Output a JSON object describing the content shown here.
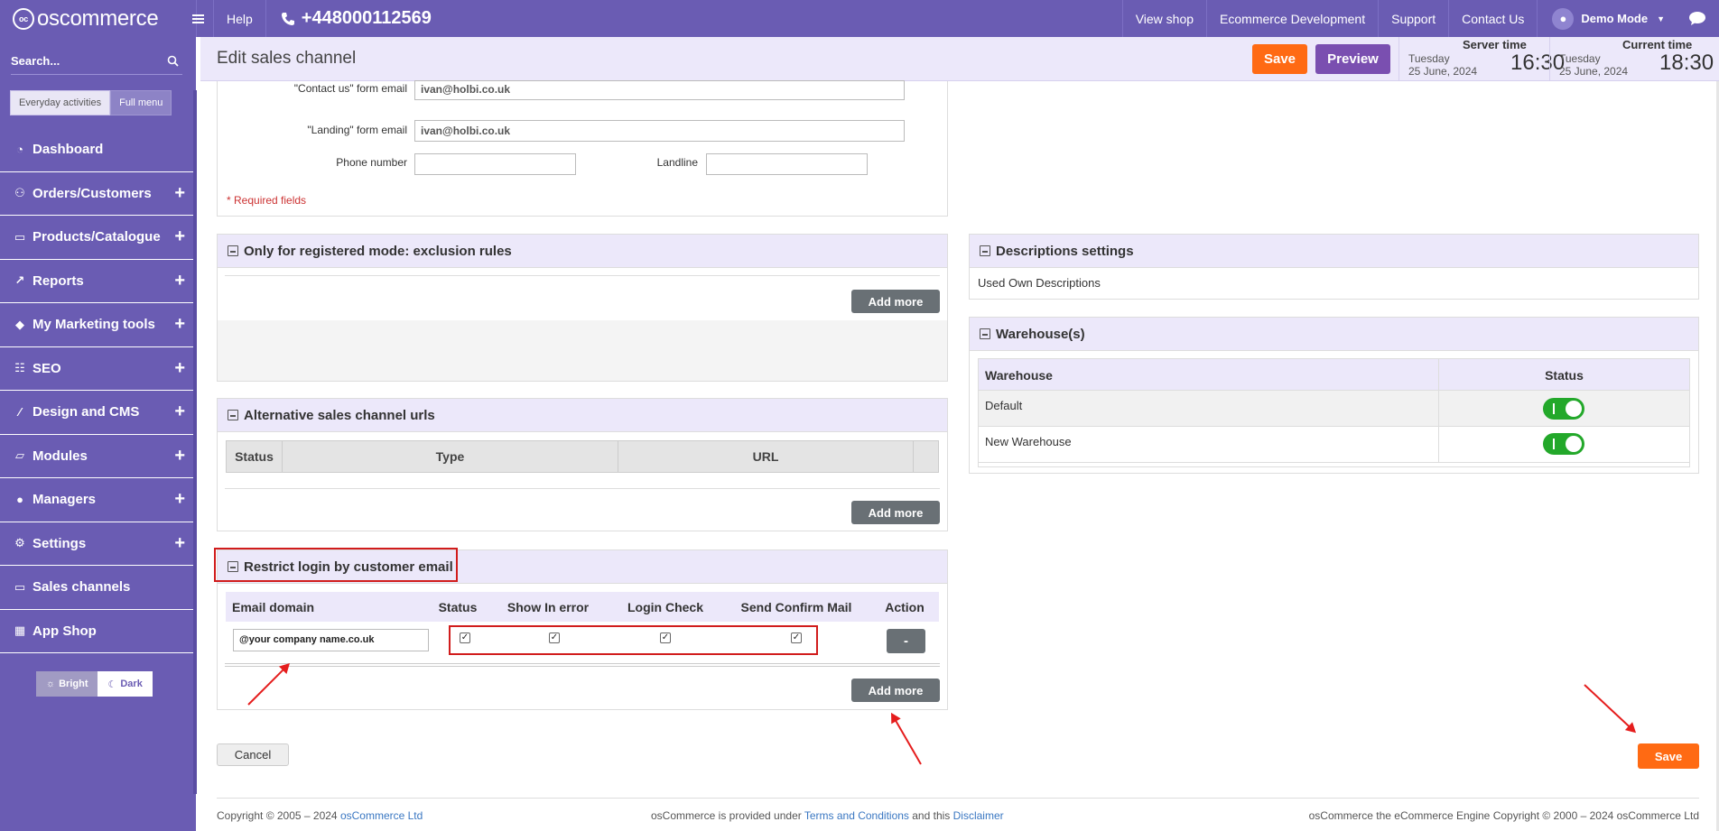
{
  "topbar": {
    "logo_text": "oscommerce",
    "help": "Help",
    "phone": "+448000112569",
    "view_shop": "View shop",
    "ecommerce_dev": "Ecommerce Development",
    "support": "Support",
    "contact_us": "Contact Us",
    "user": "Demo Mode"
  },
  "sidebar": {
    "search_label": "Search...",
    "mode_everyday": "Everyday activities",
    "mode_full": "Full menu",
    "items": [
      {
        "label": "Dashboard",
        "icon": "gauge-icon",
        "expandable": false
      },
      {
        "label": "Orders/Customers",
        "icon": "users-icon",
        "expandable": true
      },
      {
        "label": "Products/Catalogue",
        "icon": "folder-icon",
        "expandable": true
      },
      {
        "label": "Reports",
        "icon": "chart-line-icon",
        "expandable": true
      },
      {
        "label": "My Marketing tools",
        "icon": "tag-icon",
        "expandable": true
      },
      {
        "label": "SEO",
        "icon": "sitemap-icon",
        "expandable": true
      },
      {
        "label": "Design and CMS",
        "icon": "brush-icon",
        "expandable": true
      },
      {
        "label": "Modules",
        "icon": "folder-open-icon",
        "expandable": true
      },
      {
        "label": "Managers",
        "icon": "user-icon",
        "expandable": true
      },
      {
        "label": "Settings",
        "icon": "gears-icon",
        "expandable": true
      },
      {
        "label": "Sales channels",
        "icon": "monitor-icon",
        "expandable": false
      },
      {
        "label": "App Shop",
        "icon": "store-icon",
        "expandable": false
      }
    ],
    "theme_bright": "Bright",
    "theme_dark": "Dark"
  },
  "header": {
    "title": "Edit sales channel",
    "save": "Save",
    "preview": "Preview",
    "server_time_label": "Server time",
    "server_day": "Tuesday",
    "server_date": "25 June, 2024",
    "server_time": "16:30",
    "current_time_label": "Current time",
    "current_day": "Tuesday",
    "current_date": "25 June, 2024",
    "current_time": "18:30"
  },
  "contact_form": {
    "contact_us_label": "\"Contact us\" form email",
    "contact_us_value": "ivan@holbi.co.uk",
    "landing_label": "\"Landing\" form email",
    "landing_value": "ivan@holbi.co.uk",
    "phone_label": "Phone number",
    "phone_value": "",
    "landline_label": "Landline",
    "landline_value": "",
    "required": "* Required fields"
  },
  "exclusion": {
    "title": "Only for registered mode: exclusion rules",
    "add_more": "Add more"
  },
  "alt_urls": {
    "title": "Alternative sales channel urls",
    "columns": [
      "Status",
      "Type",
      "URL"
    ],
    "add_more": "Add more"
  },
  "restrict": {
    "title": "Restrict login by customer email",
    "columns": [
      "Email domain",
      "Status",
      "Show In error",
      "Login Check",
      "Send Confirm Mail",
      "Action"
    ],
    "row": {
      "domain": "@your company name.co.uk",
      "status": true,
      "show_in_error": true,
      "login_check": true,
      "send_confirm": true,
      "action": "-"
    },
    "add_more": "Add more"
  },
  "descriptions": {
    "title": "Descriptions settings",
    "value": "Used Own Descriptions"
  },
  "warehouses": {
    "title": "Warehouse(s)",
    "columns": [
      "Warehouse",
      "Status"
    ],
    "rows": [
      {
        "name": "Default",
        "enabled": true
      },
      {
        "name": "New Warehouse",
        "enabled": true
      }
    ]
  },
  "actions": {
    "cancel": "Cancel",
    "save": "Save"
  },
  "footer": {
    "copyright_prefix": "Copyright © 2005 – 2024 ",
    "copyright_link": "osCommerce Ltd",
    "middle_prefix": "osCommerce is provided under ",
    "terms": "Terms and Conditions",
    "middle_and": " and this ",
    "disclaimer": "Disclaimer",
    "right": "osCommerce the eCommerce Engine Copyright © 2000 – 2024 osCommerce Ltd"
  },
  "colors": {
    "brand_purple": "#6a5cb3",
    "accent_orange": "#ff6a13",
    "preview_purple": "#7a4fb0",
    "toggle_green": "#23a82a",
    "annotation_red": "#d11c1c"
  }
}
